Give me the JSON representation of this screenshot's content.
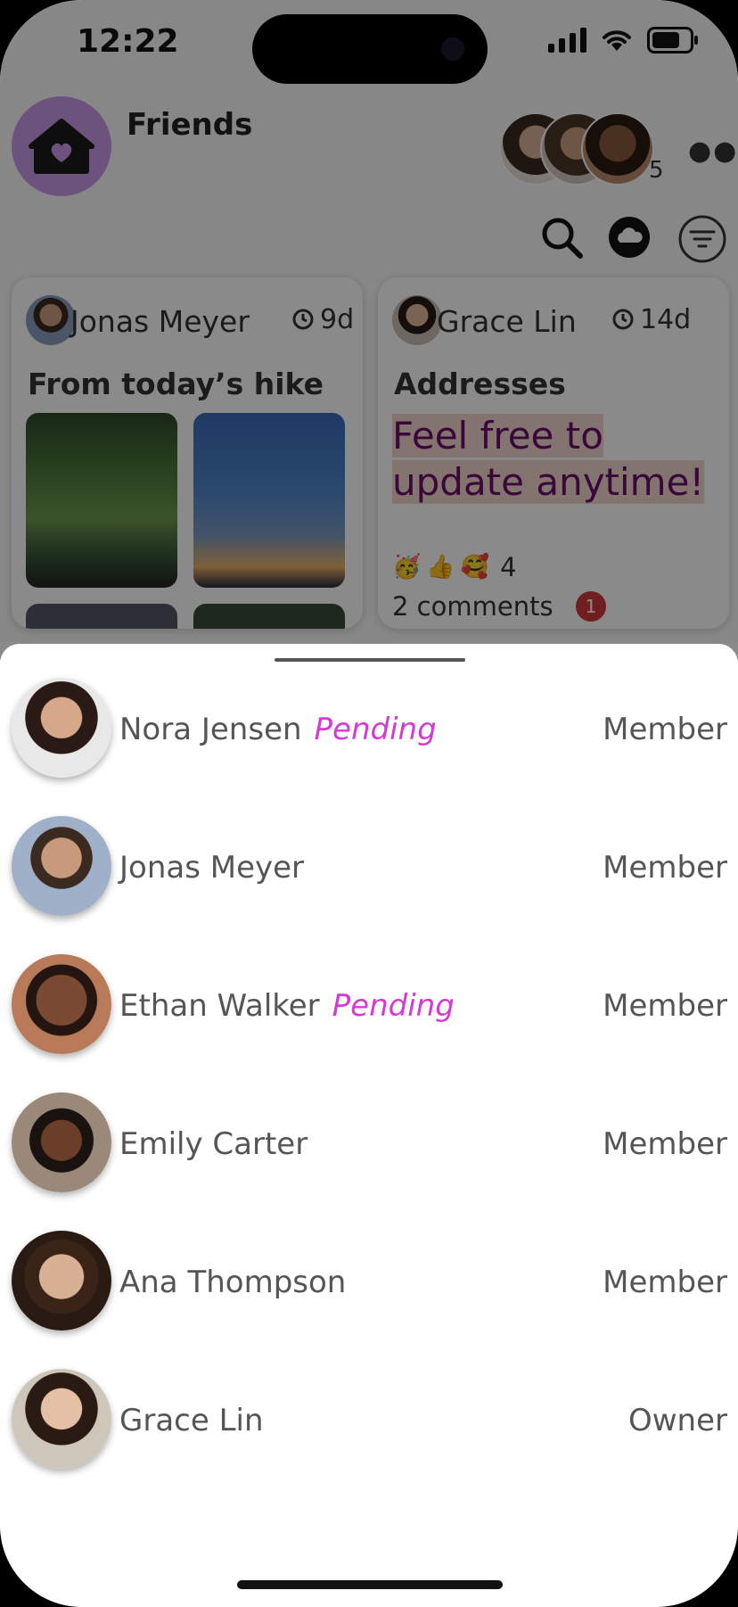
{
  "status_bar": {
    "time": "12:22"
  },
  "group": {
    "title": "Friends",
    "member_count": "5"
  },
  "cards": [
    {
      "author": "Jonas Meyer",
      "age": "9d",
      "title": "From today’s hike"
    },
    {
      "author": "Grace Lin",
      "age": "14d",
      "title": "Addresses",
      "message_line1": "Feel free to",
      "message_line2": "update anytime!",
      "reaction_count": "4",
      "comments": "2 comments",
      "unread": "1"
    }
  ],
  "members": [
    {
      "name": "Nora Jensen",
      "status": "Pending",
      "role": "Member"
    },
    {
      "name": "Jonas Meyer",
      "status": "",
      "role": "Member"
    },
    {
      "name": "Ethan Walker",
      "status": "Pending",
      "role": "Member"
    },
    {
      "name": "Emily Carter",
      "status": "",
      "role": "Member"
    },
    {
      "name": "Ana Thompson",
      "status": "",
      "role": "Member"
    },
    {
      "name": "Grace Lin",
      "status": "",
      "role": "Owner"
    }
  ],
  "colors": {
    "accent_purple": "#c89ae8",
    "pending": "#d63ad6",
    "badge": "#d03a3a"
  }
}
